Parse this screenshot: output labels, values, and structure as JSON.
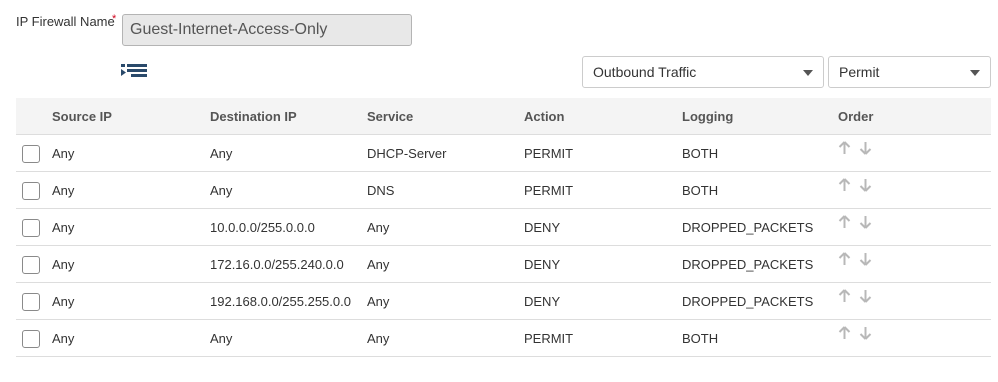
{
  "form": {
    "name_label": "IP Firewall Name",
    "required_mark": "*",
    "name_value": "Guest-Internet-Access-Only",
    "traffic_select": "Outbound Traffic",
    "action_select": "Permit"
  },
  "table": {
    "headers": {
      "source_ip": "Source IP",
      "destination_ip": "Destination IP",
      "service": "Service",
      "action": "Action",
      "logging": "Logging",
      "order": "Order"
    },
    "rows": [
      {
        "source_ip": "Any",
        "destination_ip": "Any",
        "service": "DHCP-Server",
        "action": "PERMIT",
        "logging": "BOTH"
      },
      {
        "source_ip": "Any",
        "destination_ip": "Any",
        "service": "DNS",
        "action": "PERMIT",
        "logging": "BOTH"
      },
      {
        "source_ip": "Any",
        "destination_ip": "10.0.0.0/255.0.0.0",
        "service": "Any",
        "action": "DENY",
        "logging": "DROPPED_PACKETS"
      },
      {
        "source_ip": "Any",
        "destination_ip": "172.16.0.0/255.240.0.0",
        "service": "Any",
        "action": "DENY",
        "logging": "DROPPED_PACKETS"
      },
      {
        "source_ip": "Any",
        "destination_ip": "192.168.0.0/255.255.0.0",
        "service": "Any",
        "action": "DENY",
        "logging": "DROPPED_PACKETS"
      },
      {
        "source_ip": "Any",
        "destination_ip": "Any",
        "service": "Any",
        "action": "PERMIT",
        "logging": "BOTH"
      }
    ]
  },
  "icons": {
    "list": "list-icon",
    "move_up": "arrow-up-icon",
    "move_down": "arrow-down-icon",
    "dropdown": "chevron-down-icon"
  },
  "colors": {
    "required": "#d0021b",
    "list_icon": "#2a4a6b",
    "order_arrows": "#b8b8b8",
    "header_bg": "#f4f4f4"
  }
}
